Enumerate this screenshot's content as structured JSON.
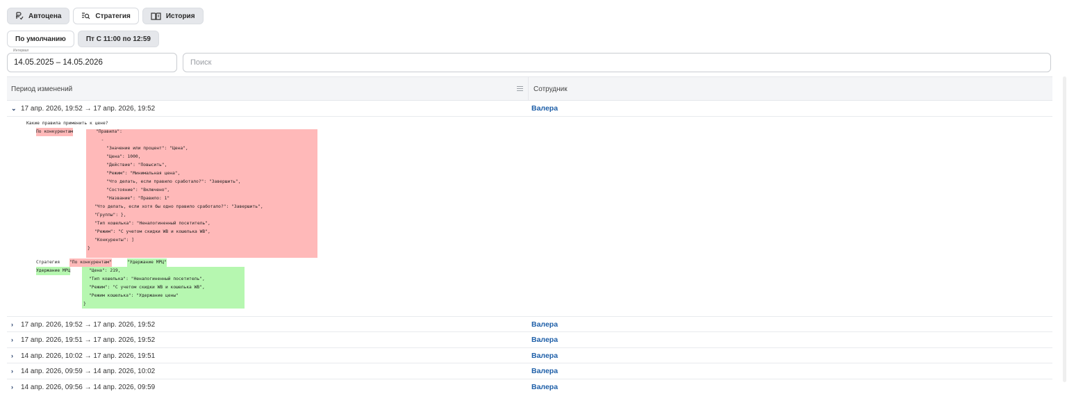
{
  "tabs": [
    {
      "label": "Автоцена",
      "icon": "price-adjust-icon"
    },
    {
      "label": "Стратегия",
      "icon": "strategy-list-search-icon"
    },
    {
      "label": "История",
      "icon": "history-book-icon"
    }
  ],
  "filters": {
    "default_label": "По умолчанию",
    "schedule_label": "Пт С 11:00 по 12:59"
  },
  "interval": {
    "label": "Интервал",
    "value": "14.05.2025 – 14.05.2026"
  },
  "search": {
    "placeholder": "Поиск"
  },
  "table": {
    "columns": [
      "Период изменений",
      "Сотрудник"
    ],
    "expanded_row": {
      "period": "17 апр. 2026, 19:52 → 17 апр. 2026, 19:52",
      "employee": "Валера",
      "diff": {
        "question": "Какие правила применить к цене?",
        "removed_key": "По конкурентам",
        "removed_lines": [
          "\"Правила\":",
          "  -",
          "    \"Значение или процент\": \"Цена\",",
          "    \"Цена\": 1000,",
          "    \"Действие\": \"Повысить\",",
          "    \"Режим\": \"Минимальная цена\",",
          "    \"Что делать, если правило сработало?\": \"Завершить\",",
          "    \"Состояние\": \"Включено\",",
          "    \"Название\": \"Правило: 1\"",
          "\"Что делать, если хотя бы одно правило сработало?\": \"Завершить\",",
          "\"Группы\": },",
          "\"Тип кошелька\": \"Неналогиненный посетитель\",",
          "\"Режим\": \"С учетом скидки WB и кошелька WB\",",
          "\"Конкуренты\": ]",
          "}"
        ],
        "strategy_label": "Стратегия",
        "strategy_old": "\"По конкурентам\"",
        "strategy_new": "\"Удержание МРЦ\"",
        "added_key": "Удержание МРЦ",
        "added_lines": [
          "\"Цена\": 219,",
          "\"Тип кошелька\": \"Неналогиненный посетитель\",",
          "\"Режим\": \"С учетом скидки WB и кошелька WB\",",
          "\"Режим кошелька\": \"Удержание цены\"",
          "}"
        ]
      }
    },
    "rows": [
      {
        "period": "17 апр. 2026, 19:52 → 17 апр. 2026, 19:52",
        "employee": "Валера"
      },
      {
        "period": "17 апр. 2026, 19:51 → 17 апр. 2026, 19:52",
        "employee": "Валера"
      },
      {
        "period": "14 апр. 2026, 10:02 → 17 апр. 2026, 19:51",
        "employee": "Валера"
      },
      {
        "period": "14 апр. 2026, 09:59 → 14 апр. 2026, 10:02",
        "employee": "Валера"
      },
      {
        "period": "14 апр. 2026, 09:56 → 14 апр. 2026, 09:59",
        "employee": "Валера"
      }
    ]
  },
  "colors": {
    "removed": "#ffb9b9",
    "added": "#b6f7b0",
    "link": "#1e5fa8"
  }
}
